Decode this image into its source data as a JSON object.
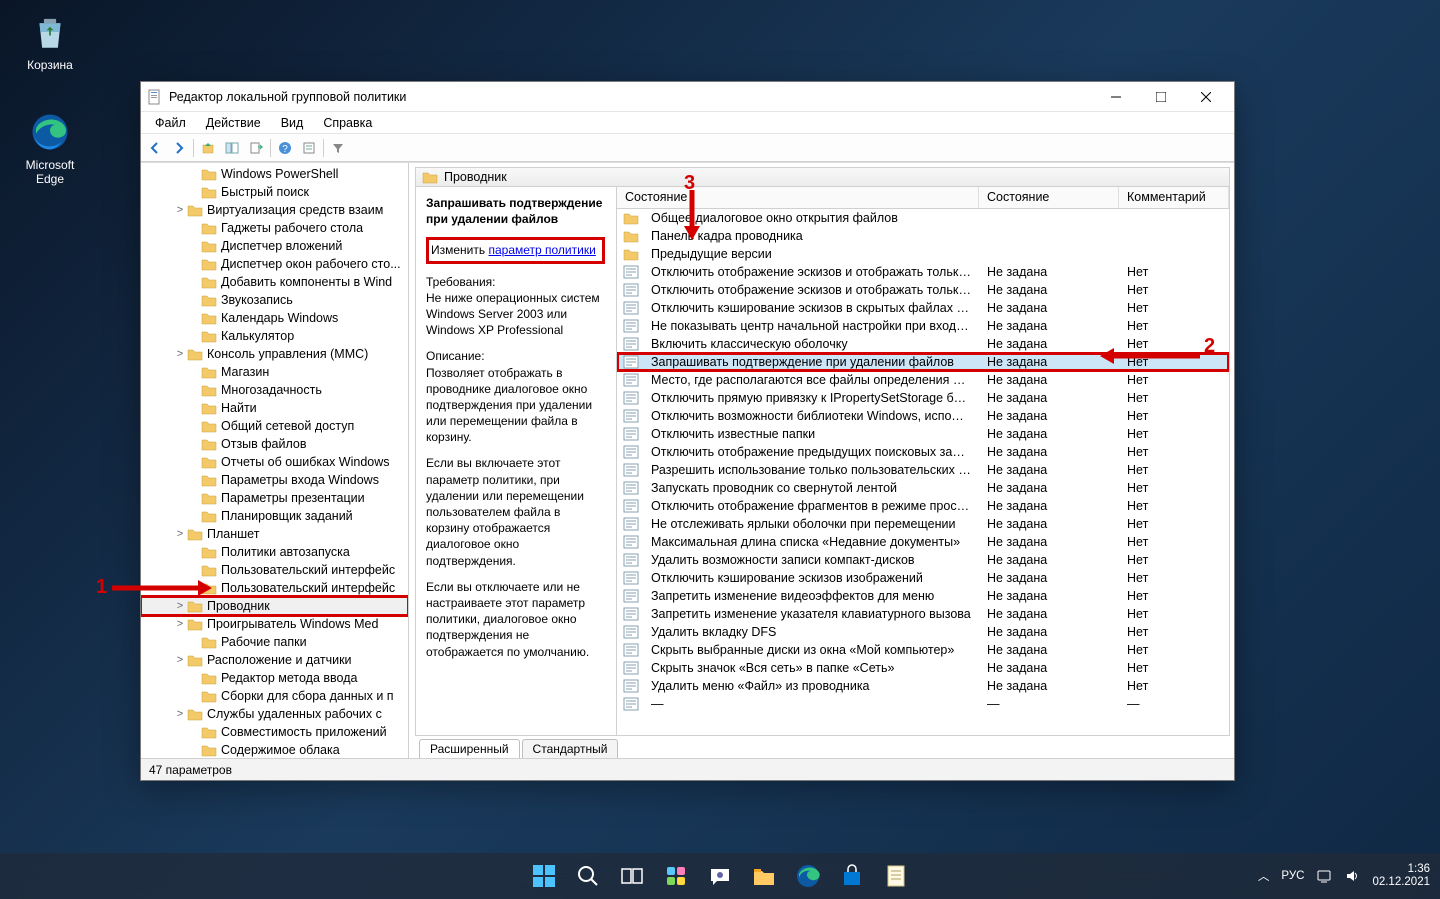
{
  "desktop": {
    "recycle_bin": "Корзина",
    "edge": "Microsoft Edge"
  },
  "window": {
    "title": "Редактор локальной групповой политики",
    "menu": {
      "file": "Файл",
      "action": "Действие",
      "view": "Вид",
      "help": "Справка"
    }
  },
  "tree": [
    {
      "label": "Windows PowerShell",
      "expand": "",
      "indent": 46
    },
    {
      "label": "Быстрый поиск",
      "expand": "",
      "indent": 46
    },
    {
      "label": "Виртуализация средств взаим",
      "expand": ">",
      "indent": 32
    },
    {
      "label": "Гаджеты рабочего стола",
      "expand": "",
      "indent": 46
    },
    {
      "label": "Диспетчер вложений",
      "expand": "",
      "indent": 46
    },
    {
      "label": "Диспетчер окон рабочего сто...",
      "expand": "",
      "indent": 46
    },
    {
      "label": "Добавить компоненты в Wind",
      "expand": "",
      "indent": 46
    },
    {
      "label": "Звукозапись",
      "expand": "",
      "indent": 46
    },
    {
      "label": "Календарь Windows",
      "expand": "",
      "indent": 46
    },
    {
      "label": "Калькулятор",
      "expand": "",
      "indent": 46
    },
    {
      "label": "Консоль управления (MMC)",
      "expand": ">",
      "indent": 32
    },
    {
      "label": "Магазин",
      "expand": "",
      "indent": 46
    },
    {
      "label": "Многозадачность",
      "expand": "",
      "indent": 46
    },
    {
      "label": "Найти",
      "expand": "",
      "indent": 46
    },
    {
      "label": "Общий сетевой доступ",
      "expand": "",
      "indent": 46
    },
    {
      "label": "Отзыв файлов",
      "expand": "",
      "indent": 46
    },
    {
      "label": "Отчеты об ошибках Windows",
      "expand": "",
      "indent": 46
    },
    {
      "label": "Параметры входа Windows",
      "expand": "",
      "indent": 46
    },
    {
      "label": "Параметры презентации",
      "expand": "",
      "indent": 46
    },
    {
      "label": "Планировщик заданий",
      "expand": "",
      "indent": 46
    },
    {
      "label": "Планшет",
      "expand": ">",
      "indent": 32
    },
    {
      "label": "Политики автозапуска",
      "expand": "",
      "indent": 46
    },
    {
      "label": "Пользовательский интерфейс",
      "expand": "",
      "indent": 46
    },
    {
      "label": "Пользовательский интерфейс",
      "expand": "",
      "indent": 46
    },
    {
      "label": "Проводник",
      "expand": ">",
      "indent": 32,
      "selected": true
    },
    {
      "label": "Проигрыватель Windows Med",
      "expand": ">",
      "indent": 32
    },
    {
      "label": "Рабочие папки",
      "expand": "",
      "indent": 46
    },
    {
      "label": "Расположение и датчики",
      "expand": ">",
      "indent": 32
    },
    {
      "label": "Редактор метода ввода",
      "expand": "",
      "indent": 46
    },
    {
      "label": "Сборки для сбора данных и п",
      "expand": "",
      "indent": 46
    },
    {
      "label": "Службы удаленных рабочих с",
      "expand": ">",
      "indent": 32
    },
    {
      "label": "Совместимость приложений",
      "expand": "",
      "indent": 46
    },
    {
      "label": "Содержимое облака",
      "expand": "",
      "indent": 46
    }
  ],
  "right_header": "Проводник",
  "desc": {
    "title": "Запрашивать подтверждение при удалении файлов",
    "edit_prefix": "Изменить ",
    "edit_link": "параметр политики",
    "req_label": "Требования:",
    "req_text": "Не ниже операционных систем Windows Server 2003 или Windows XP Professional",
    "desc_label": "Описание:",
    "desc_p1": "Позволяет отображать в проводнике диалоговое окно подтверждения при удалении или перемещении файла в корзину.",
    "desc_p2": "Если вы включаете этот параметр политики, при удалении или перемещении пользователем файла в корзину отображается диалоговое окно подтверждения.",
    "desc_p3": "Если вы отключаете или не настраиваете этот параметр политики, диалоговое окно подтверждения не отображается по умолчанию."
  },
  "list_header": {
    "name": "Состояние",
    "state": "Состояние",
    "comment": "Комментарий"
  },
  "rows": [
    {
      "type": "folder",
      "name": "Общее диалоговое окно открытия файлов",
      "state": "",
      "comment": ""
    },
    {
      "type": "folder",
      "name": "Панель кадра проводника",
      "state": "",
      "comment": ""
    },
    {
      "type": "folder",
      "name": "Предыдущие версии",
      "state": "",
      "comment": ""
    },
    {
      "type": "setting",
      "name": "Отключить отображение эскизов и отображать только з...",
      "state": "Не задана",
      "comment": "Нет"
    },
    {
      "type": "setting",
      "name": "Отключить отображение эскизов и отображать только з...",
      "state": "Не задана",
      "comment": "Нет"
    },
    {
      "type": "setting",
      "name": "Отключить кэширование эскизов в скрытых файлах thu...",
      "state": "Не задана",
      "comment": "Нет"
    },
    {
      "type": "setting",
      "name": "Не показывать центр начальной настройки при входе по...",
      "state": "Не задана",
      "comment": "Нет"
    },
    {
      "type": "setting",
      "name": "Включить классическую оболочку",
      "state": "Не задана",
      "comment": "Нет"
    },
    {
      "type": "setting",
      "name": "Запрашивать подтверждение при удалении файлов",
      "state": "Не задана",
      "comment": "Нет",
      "selected": true,
      "highlight": true
    },
    {
      "type": "setting",
      "name": "Место, где располагаются все файлы определения библ...",
      "state": "Не задана",
      "comment": "Нет"
    },
    {
      "type": "setting",
      "name": "Отключить прямую привязку к IPropertySetStorage без пр...",
      "state": "Не задана",
      "comment": "Нет"
    },
    {
      "type": "setting",
      "name": "Отключить возможности библиотеки Windows, использ...",
      "state": "Не задана",
      "comment": "Нет"
    },
    {
      "type": "setting",
      "name": "Отключить известные папки",
      "state": "Не задана",
      "comment": "Нет"
    },
    {
      "type": "setting",
      "name": "Отключить отображение предыдущих поисковых запро...",
      "state": "Не задана",
      "comment": "Нет"
    },
    {
      "type": "setting",
      "name": "Разрешить использование только пользовательских или...",
      "state": "Не задана",
      "comment": "Нет"
    },
    {
      "type": "setting",
      "name": "Запускать проводник со свернутой лентой",
      "state": "Не задана",
      "comment": "Нет"
    },
    {
      "type": "setting",
      "name": "Отключить отображение фрагментов в режиме просмот...",
      "state": "Не задана",
      "comment": "Нет"
    },
    {
      "type": "setting",
      "name": "Не отслеживать ярлыки оболочки при перемещении",
      "state": "Не задана",
      "comment": "Нет"
    },
    {
      "type": "setting",
      "name": "Максимальная длина списка «Недавние документы»",
      "state": "Не задана",
      "comment": "Нет"
    },
    {
      "type": "setting",
      "name": "Удалить возможности записи компакт-дисков",
      "state": "Не задана",
      "comment": "Нет"
    },
    {
      "type": "setting",
      "name": "Отключить кэширование эскизов изображений",
      "state": "Не задана",
      "comment": "Нет"
    },
    {
      "type": "setting",
      "name": "Запретить изменение видеоэффектов для меню",
      "state": "Не задана",
      "comment": "Нет"
    },
    {
      "type": "setting",
      "name": "Запретить изменение указателя клавиатурного вызова",
      "state": "Не задана",
      "comment": "Нет"
    },
    {
      "type": "setting",
      "name": "Удалить вкладку DFS",
      "state": "Не задана",
      "comment": "Нет"
    },
    {
      "type": "setting",
      "name": "Скрыть выбранные диски из окна «Мой компьютер»",
      "state": "Не задана",
      "comment": "Нет"
    },
    {
      "type": "setting",
      "name": "Скрыть значок «Вся сеть» в папке «Сеть»",
      "state": "Не задана",
      "comment": "Нет"
    },
    {
      "type": "setting",
      "name": "Удалить меню «Файл» из проводника",
      "state": "Не задана",
      "comment": "Нет"
    },
    {
      "type": "setting",
      "name": "—",
      "state": "—",
      "comment": "—"
    }
  ],
  "tabs": {
    "extended": "Расширенный",
    "standard": "Стандартный"
  },
  "statusbar": "47 параметров",
  "annotations": {
    "n1": "1",
    "n2": "2",
    "n3": "3"
  },
  "systray": {
    "lang": "РУС",
    "time": "1:36",
    "date": "02.12.2021"
  }
}
